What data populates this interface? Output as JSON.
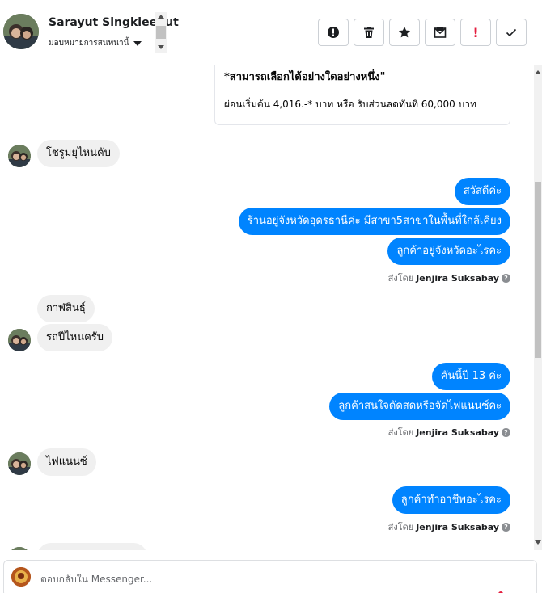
{
  "header": {
    "contact_name": "Sarayut Singkleebut",
    "assign_label": "มอบหมายการสนทนานี้"
  },
  "toolbar": {
    "buttons": [
      {
        "icon": "alert-circle-icon"
      },
      {
        "icon": "trash-icon"
      },
      {
        "icon": "star-icon"
      },
      {
        "icon": "mark-unread-icon"
      },
      {
        "icon": "exclamation-icon",
        "glyph": "!"
      },
      {
        "icon": "checkmark-icon"
      }
    ]
  },
  "card": {
    "title": "*สามารถเลือกได้อย่างใดอย่างหนึ่ง\"",
    "text": "ผ่อนเริ่มต้น 4,016.-* บาท หรือ รับส่วนลดทันที 60,000 บาท"
  },
  "messages": [
    {
      "dir": "in",
      "text": "โชรูมยุไหนคับ"
    },
    {
      "dir": "out",
      "text": "สวัสดีค่ะ"
    },
    {
      "dir": "out",
      "text": "ร้านอยู่จังหวัดอุดรธานีค่ะ มีสาขา5สาขาในพื้นที่ใกล้เคียง"
    },
    {
      "dir": "out",
      "text": "ลูกค้าอยู่จังหวัดอะไรคะ"
    },
    {
      "dir": "in",
      "text": "กาฬสินธุ์"
    },
    {
      "dir": "in",
      "text": "รถปีไหนครับ"
    },
    {
      "dir": "out",
      "text": "คันนี้ปี 13 ค่ะ"
    },
    {
      "dir": "out",
      "text": "ลูกค้าสนใจดัดสดหรือจัดไฟแนนซ์คะ"
    },
    {
      "dir": "in",
      "text": "ไฟแนนซ์"
    },
    {
      "dir": "out",
      "text": "ลูกค้าทำอาชีพอะไรคะ"
    }
  ],
  "sent_by": {
    "prefix": "ส่งโดย",
    "agent": "Jenjira Suksabay",
    "help_glyph": "?"
  },
  "reply": {
    "placeholder": "ตอบกลับใน Messenger..."
  },
  "colors": {
    "outgoing_bubble": "#0084ff",
    "incoming_bubble": "#f0f0f0",
    "alert": "#e41e3f"
  }
}
